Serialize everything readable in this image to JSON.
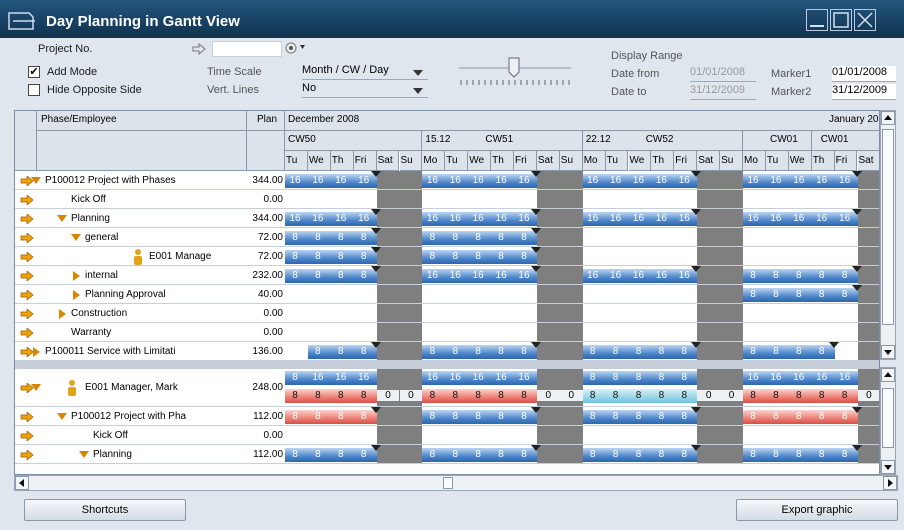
{
  "window": {
    "title": "Day Planning in Gantt View"
  },
  "form": {
    "project_no_label": "Project No.",
    "add_mode_label": "Add Mode",
    "add_mode_checked": "✔",
    "hide_side_label": "Hide Opposite Side",
    "time_scale_label": "Time Scale",
    "time_scale_value": "Month / CW / Day",
    "vert_lines_label": "Vert. Lines",
    "vert_lines_value": "No",
    "display_range_label": "Display Range",
    "date_from_label": "Date from",
    "date_from_value": "01/01/2008",
    "date_to_label": "Date to",
    "date_to_value": "31/12/2009",
    "marker1_label": "Marker1",
    "marker1_value": "01/01/2008",
    "marker2_label": "Marker2",
    "marker2_value": "31/12/2009"
  },
  "grid": {
    "col_phase": "Phase/Employee",
    "col_plan": "Plan",
    "months": [
      {
        "label": "December 2008"
      },
      {
        "label": "January 20"
      }
    ],
    "weeks": [
      {
        "date": "",
        "cw": "CW50"
      },
      {
        "date": "15.12",
        "cw": "CW51"
      },
      {
        "date": "22.12",
        "cw": "CW52"
      },
      {
        "date": "",
        "cw": "CW01"
      },
      {
        "date": "",
        "cw": "CW01"
      }
    ],
    "days": [
      "Tu",
      "We",
      "Th",
      "Fri",
      "Sat",
      "Su",
      "Mo",
      "Tu",
      "We",
      "Th",
      "Fri",
      "Sat",
      "Su",
      "Mo",
      "Tu",
      "We",
      "Th",
      "Fri",
      "Sat",
      "Su",
      "Mo",
      "Tu",
      "We",
      "Th",
      "Fri",
      "Sat"
    ],
    "rows": [
      {
        "label": "P100012  Project with Phases",
        "plan": "344.00"
      },
      {
        "label": "Kick Off",
        "plan": "0.00"
      },
      {
        "label": "Planning",
        "plan": "344.00"
      },
      {
        "label": "general",
        "plan": "72.00"
      },
      {
        "label": "E001 Manage",
        "plan": "72.00"
      },
      {
        "label": "internal",
        "plan": "232.00"
      },
      {
        "label": "Planning Approval",
        "plan": "40.00"
      },
      {
        "label": "Construction",
        "plan": "0.00"
      },
      {
        "label": "Warranty",
        "plan": "0.00"
      },
      {
        "label": "P100011  Service with Limitati",
        "plan": "136.00"
      },
      {
        "label": "E001 Manager, Mark",
        "plan": "248.00"
      },
      {
        "label": "P100012  Project with Pha",
        "plan": "112.00"
      },
      {
        "label": "Kick Off",
        "plan": "0.00"
      },
      {
        "label": "Planning",
        "plan": "112.00"
      }
    ],
    "bar_values": {
      "sixteen": "16",
      "eight": "8",
      "zero": "0"
    }
  },
  "footer": {
    "shortcuts": "Shortcuts",
    "export": "Export graphic"
  },
  "colors": {
    "title_bg": "#1b4669",
    "bar_blue": "#4d86cb",
    "bar_red": "#ee7e74",
    "weekend": "#7f7f7f"
  }
}
